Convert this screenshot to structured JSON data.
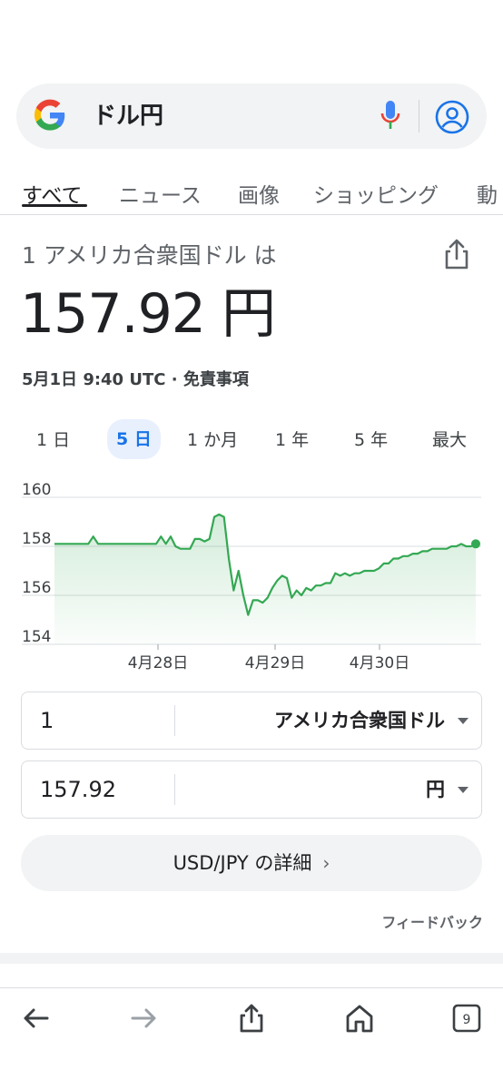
{
  "search": {
    "query": "ドル円"
  },
  "tabs": [
    {
      "label": "すべて",
      "active": true
    },
    {
      "label": "ニュース",
      "active": false
    },
    {
      "label": "画像",
      "active": false
    },
    {
      "label": "ショッピング",
      "active": false
    },
    {
      "label": "動",
      "active": false
    }
  ],
  "conversion": {
    "from_label": "1 アメリカ合衆国ドル は",
    "value": "157.92 円",
    "meta": "5月1日 9:40 UTC · 免責事項"
  },
  "ranges": [
    "1 日",
    "5 日",
    "1 か月",
    "1 年",
    "5 年",
    "最大"
  ],
  "active_range": "5 日",
  "chart_data": {
    "type": "area",
    "y_ticks": [
      "160",
      "158",
      "156",
      "154"
    ],
    "ylim": [
      154,
      160
    ],
    "x_ticks": [
      "4月28日",
      "4月29日",
      "4月30日"
    ],
    "color": "#34a853",
    "series": [
      {
        "values": [
          158.1,
          158.1,
          158.1,
          158.1,
          158.1,
          158.1,
          158.1,
          158.1,
          158.4,
          158.1,
          158.1,
          158.1,
          158.1,
          158.1,
          158.1,
          158.1,
          158.1,
          158.1,
          158.1,
          158.1,
          158.1,
          158.1,
          158.4,
          158.1,
          158.4,
          158.0,
          157.9,
          157.9,
          157.9,
          158.3,
          158.3,
          158.2,
          158.3,
          159.2,
          159.3,
          159.2,
          157.5,
          156.2,
          157.0,
          156.0,
          155.2,
          155.8,
          155.8,
          155.7,
          155.9,
          156.3,
          156.6,
          156.8,
          156.7,
          155.9,
          156.2,
          156.0,
          156.3,
          156.2,
          156.4,
          156.4,
          156.5,
          156.5,
          156.9,
          156.8,
          156.9,
          156.8,
          156.9,
          156.9,
          157.0,
          157.0,
          157.0,
          157.1,
          157.3,
          157.3,
          157.5,
          157.5,
          157.6,
          157.6,
          157.7,
          157.7,
          157.8,
          157.8,
          157.9,
          157.9,
          157.9,
          157.9,
          158.0,
          158.0,
          158.1,
          158.0,
          158.0,
          158.1
        ]
      }
    ],
    "grid": true,
    "fill": "gradient"
  },
  "converter": {
    "from_amount": "1",
    "from_currency": "アメリカ合衆国ドル",
    "to_amount": "157.92",
    "to_currency": "円"
  },
  "details_button": "USD/JPY の詳細",
  "feedback": "フィードバック",
  "bottom_nav": {
    "tab_count": "9"
  }
}
